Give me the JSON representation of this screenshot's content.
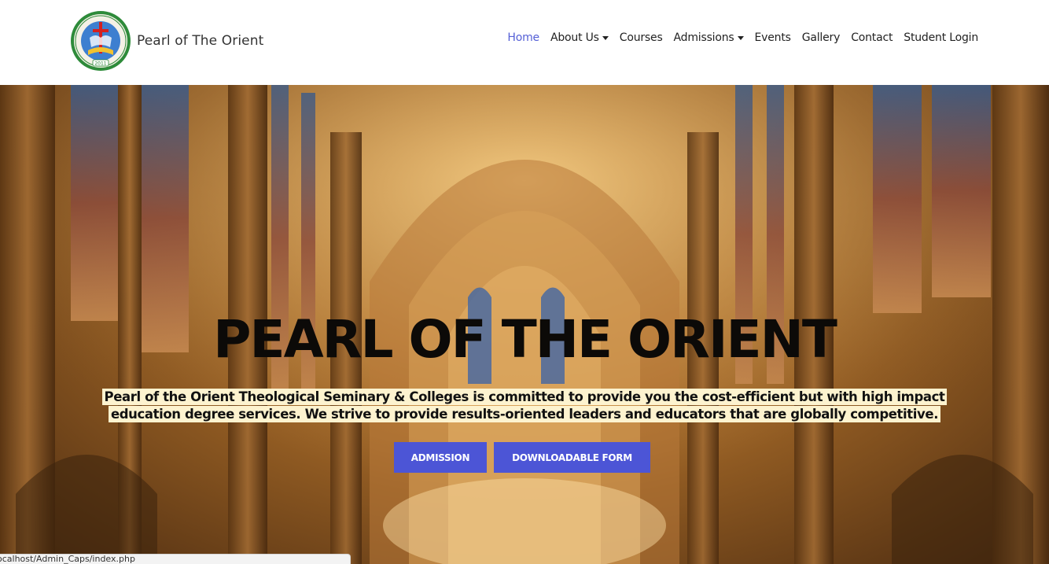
{
  "brand": {
    "name": "Pearl of The Orient",
    "logo_year": "2011"
  },
  "nav": {
    "items": [
      {
        "label": "Home",
        "active": true,
        "dropdown": false
      },
      {
        "label": "About Us",
        "active": false,
        "dropdown": true
      },
      {
        "label": "Courses",
        "active": false,
        "dropdown": false
      },
      {
        "label": "Admissions",
        "active": false,
        "dropdown": true
      },
      {
        "label": "Events",
        "active": false,
        "dropdown": false
      },
      {
        "label": "Gallery",
        "active": false,
        "dropdown": false
      },
      {
        "label": "Contact",
        "active": false,
        "dropdown": false
      },
      {
        "label": "Student Login",
        "active": false,
        "dropdown": false
      }
    ]
  },
  "hero": {
    "title": "PEARL OF THE ORIENT",
    "description": "Pearl of the Orient Theological Seminary & Colleges is committed to provide you the cost-efficient but with high impact education degree services. We strive to provide results-oriented leaders and educators that are globally competitive.",
    "buttons": {
      "admission": "ADMISSION",
      "form": "DOWNLOADABLE FORM"
    }
  },
  "status": {
    "url": "ocalhost/Admin_Caps/index.php"
  },
  "colors": {
    "accent": "#4c55d6",
    "active_nav": "#5560d6",
    "highlight": "#fdf3cf"
  }
}
